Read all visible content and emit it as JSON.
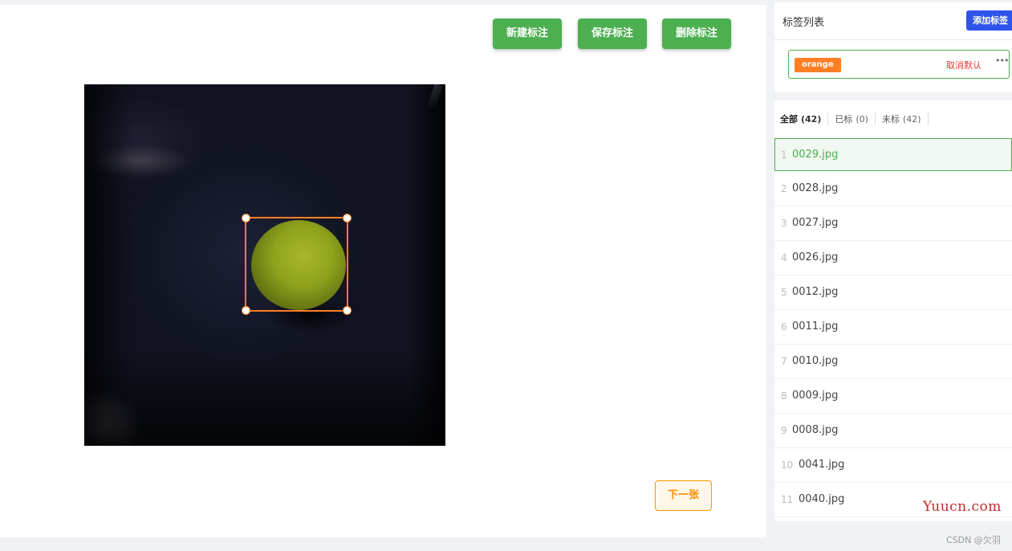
{
  "toolbar": {
    "new_label": "新建标注",
    "save_label": "保存标注",
    "delete_label": "删除标注"
  },
  "next_button": "下一张",
  "annotation": {
    "label": "orange",
    "box_color": "#ff7f27"
  },
  "label_panel": {
    "title": "标签列表",
    "add_button": "添加标签",
    "labels": [
      {
        "name": "orange",
        "action": "取消默认",
        "more": "•••"
      }
    ]
  },
  "file_tabs": [
    {
      "label": "全部",
      "count": "(42)"
    },
    {
      "label": "已标",
      "count": "(0)"
    },
    {
      "label": "未标",
      "count": "(42)"
    }
  ],
  "files": [
    {
      "index": "1",
      "name": "0029.jpg"
    },
    {
      "index": "2",
      "name": "0028.jpg"
    },
    {
      "index": "3",
      "name": "0027.jpg"
    },
    {
      "index": "4",
      "name": "0026.jpg"
    },
    {
      "index": "5",
      "name": "0012.jpg"
    },
    {
      "index": "6",
      "name": "0011.jpg"
    },
    {
      "index": "7",
      "name": "0010.jpg"
    },
    {
      "index": "8",
      "name": "0009.jpg"
    },
    {
      "index": "9",
      "name": "0008.jpg"
    },
    {
      "index": "10",
      "name": "0041.jpg"
    },
    {
      "index": "11",
      "name": "0040.jpg"
    }
  ],
  "watermark": "Yuucn.com",
  "footer_credit": "CSDN @欠羽",
  "colors": {
    "primary_green": "#4caf50",
    "accent_orange": "#ff7f27",
    "add_blue": "#2f54eb",
    "cancel_red": "#e53935"
  }
}
